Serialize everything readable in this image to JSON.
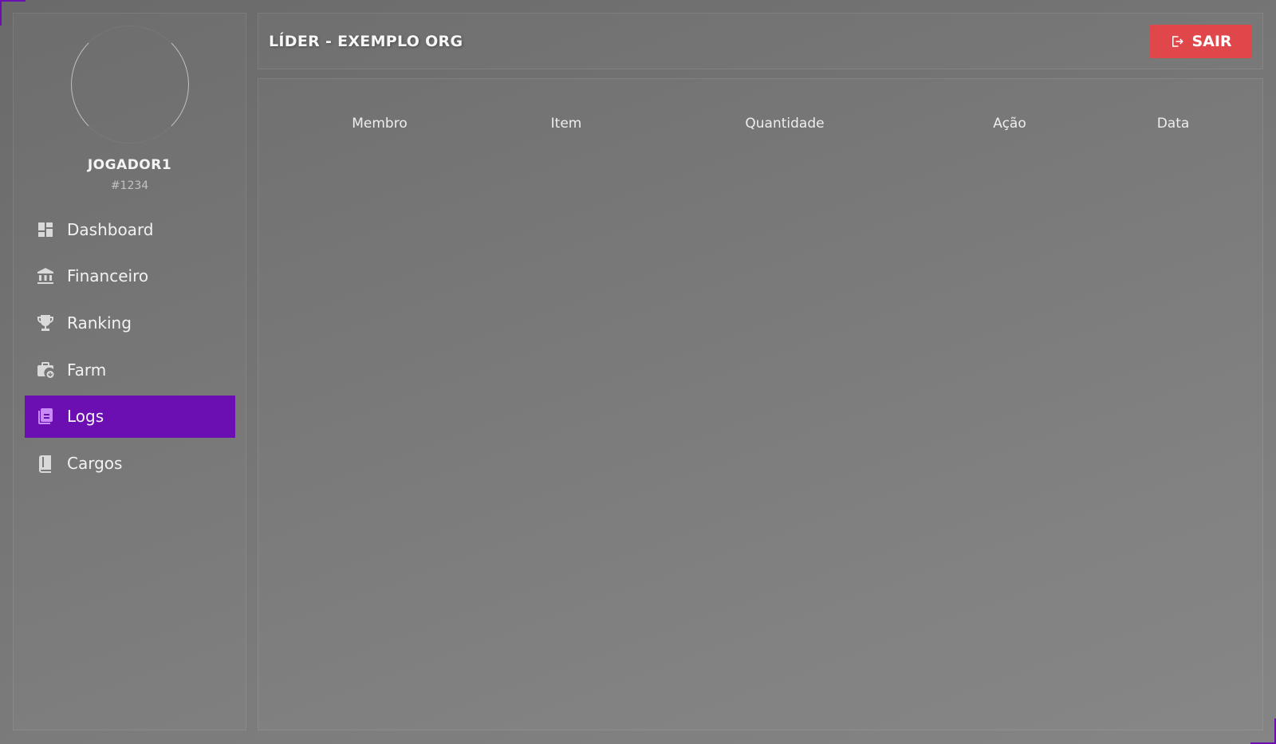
{
  "user": {
    "name": "JOGADOR1",
    "tag": "#1234"
  },
  "nav": {
    "items": [
      {
        "label": "Dashboard",
        "icon": "dashboard-icon"
      },
      {
        "label": "Financeiro",
        "icon": "bank-icon"
      },
      {
        "label": "Ranking",
        "icon": "trophy-icon"
      },
      {
        "label": "Farm",
        "icon": "briefcase-icon"
      },
      {
        "label": "Logs",
        "icon": "logs-icon"
      },
      {
        "label": "Cargos",
        "icon": "book-icon"
      }
    ],
    "active": "Logs"
  },
  "header": {
    "title": "LÍDER - EXEMPLO ORG",
    "logout_label": "SAIR"
  },
  "table": {
    "columns": [
      "Membro",
      "Item",
      "Quantidade",
      "Ação",
      "Data"
    ],
    "rows": []
  },
  "colors": {
    "accent": "#6b0fb3",
    "danger": "#e0474b"
  }
}
